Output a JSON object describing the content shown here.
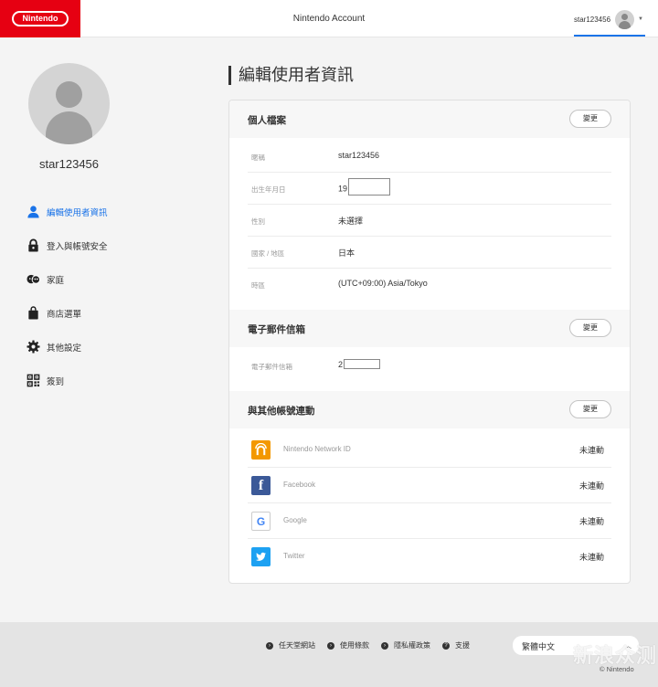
{
  "header": {
    "logo_text": "Nintendo",
    "title": "Nintendo Account",
    "username": "star123456",
    "accent_color": "#e60012",
    "underline_color": "#1a73e8"
  },
  "sidebar": {
    "profile_name": "star123456",
    "items": [
      {
        "icon": "user-icon",
        "label": "編輯使用者資訊",
        "active": true
      },
      {
        "icon": "lock-icon",
        "label": "登入與帳號安全",
        "active": false
      },
      {
        "icon": "family-icon",
        "label": "家庭",
        "active": false
      },
      {
        "icon": "shopping-bag-icon",
        "label": "商店選單",
        "active": false
      },
      {
        "icon": "gear-icon",
        "label": "其他設定",
        "active": false
      },
      {
        "icon": "qr-code-icon",
        "label": "簽到",
        "active": false
      }
    ]
  },
  "main": {
    "page_title": "編輯使用者資訊",
    "profile_section": {
      "title": "個人檔案",
      "change_label": "變更",
      "rows": [
        {
          "label": "暱稱",
          "value": "star123456"
        },
        {
          "label": "出生年月日",
          "value": "19"
        },
        {
          "label": "性別",
          "value": "未選擇"
        },
        {
          "label": "國家 / 地區",
          "value": "日本"
        },
        {
          "label": "時區",
          "value": "(UTC+09:00) Asia/Tokyo"
        }
      ]
    },
    "email_section": {
      "title": "電子郵件信箱",
      "change_label": "變更",
      "label": "電子郵件信箱",
      "value": "2"
    },
    "link_section": {
      "title": "與其他帳號連動",
      "change_label": "變更",
      "services": [
        {
          "icon": "nintendo-network-icon",
          "name": "Nintendo Network ID",
          "status": "未連動",
          "color": "#f39800"
        },
        {
          "icon": "facebook-icon",
          "name": "Facebook",
          "status": "未連動",
          "color": "#3b5998"
        },
        {
          "icon": "google-icon",
          "name": "Google",
          "status": "未連動",
          "color": "#4285f4"
        },
        {
          "icon": "twitter-icon",
          "name": "Twitter",
          "status": "未連動",
          "color": "#1da1f2"
        }
      ]
    }
  },
  "footer": {
    "links": [
      "任天堂網站",
      "使用條款",
      "隱私權政策",
      "支援"
    ],
    "language": "繁體中文",
    "copyright": "© Nintendo"
  },
  "watermark": "新浪众测"
}
